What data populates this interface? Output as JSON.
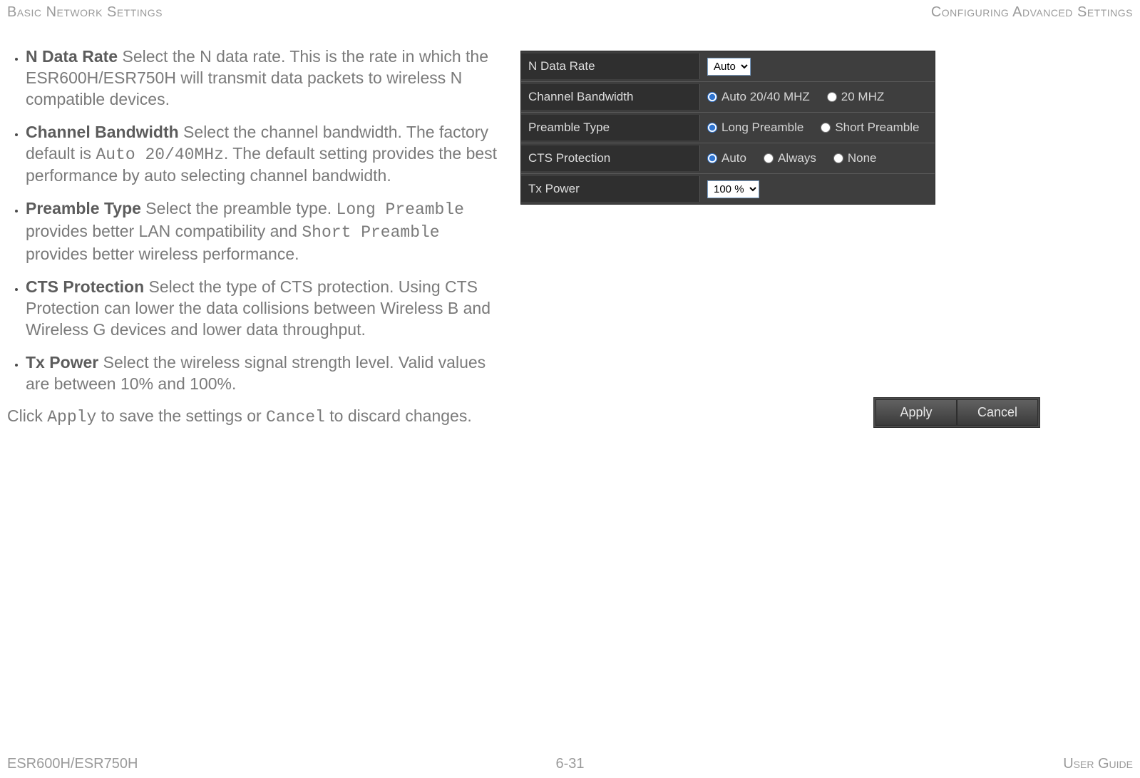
{
  "header": {
    "left": "Basic Network Settings",
    "right": "Configuring Advanced Settings"
  },
  "definitions": {
    "n_data_rate": {
      "term": "N Data Rate",
      "desc": "  Select the N data rate. This is the rate in which the ESR600H/ESR750H will transmit data packets to wireless N compatible devices."
    },
    "channel_bw": {
      "term": "Channel Bandwidth",
      "pre": "  Select the channel bandwidth. The factory default is ",
      "code": "Auto 20/40MHz",
      "post": ". The default setting provides the best performance by auto selecting channel bandwidth."
    },
    "preamble": {
      "term": "Preamble Type",
      "pre": "  Select the preamble type. ",
      "code1": "Long Pre­amble",
      "mid": " provides better LAN compatibility and ",
      "code2": "Short Preamble",
      "post": " provides better wireless performance."
    },
    "cts": {
      "term": "CTS Protection",
      "desc": "  Select the type of CTS protection. Using CTS Protection can lower the data collisions between Wireless B and Wireless G devices and lower data throughput."
    },
    "txpower": {
      "term": "Tx Power",
      "desc": "  Select the wireless signal strength level. Valid values are between 10% and 100%."
    }
  },
  "apply_sentence": {
    "pre": "Click ",
    "apply": "Apply",
    "mid": " to save the settings or ",
    "cancel": "Cancel",
    "post": " to discard changes."
  },
  "panel": {
    "rows": {
      "n_data_rate": {
        "label": "N Data Rate",
        "value": "Auto"
      },
      "channel_bw": {
        "label": "Channel Bandwidth",
        "opt1": "Auto 20/40 MHZ",
        "opt2": "20 MHZ"
      },
      "preamble": {
        "label": "Preamble Type",
        "opt1": "Long Preamble",
        "opt2": "Short Preamble"
      },
      "cts": {
        "label": "CTS Protection",
        "opt1": "Auto",
        "opt2": "Always",
        "opt3": "None"
      },
      "txpower": {
        "label": "Tx Power",
        "value": "100 %"
      }
    }
  },
  "buttons": {
    "apply": "Apply",
    "cancel": "Cancel"
  },
  "footer": {
    "left": "ESR600H/ESR750H",
    "center": "6-31",
    "right": "User Guide"
  }
}
